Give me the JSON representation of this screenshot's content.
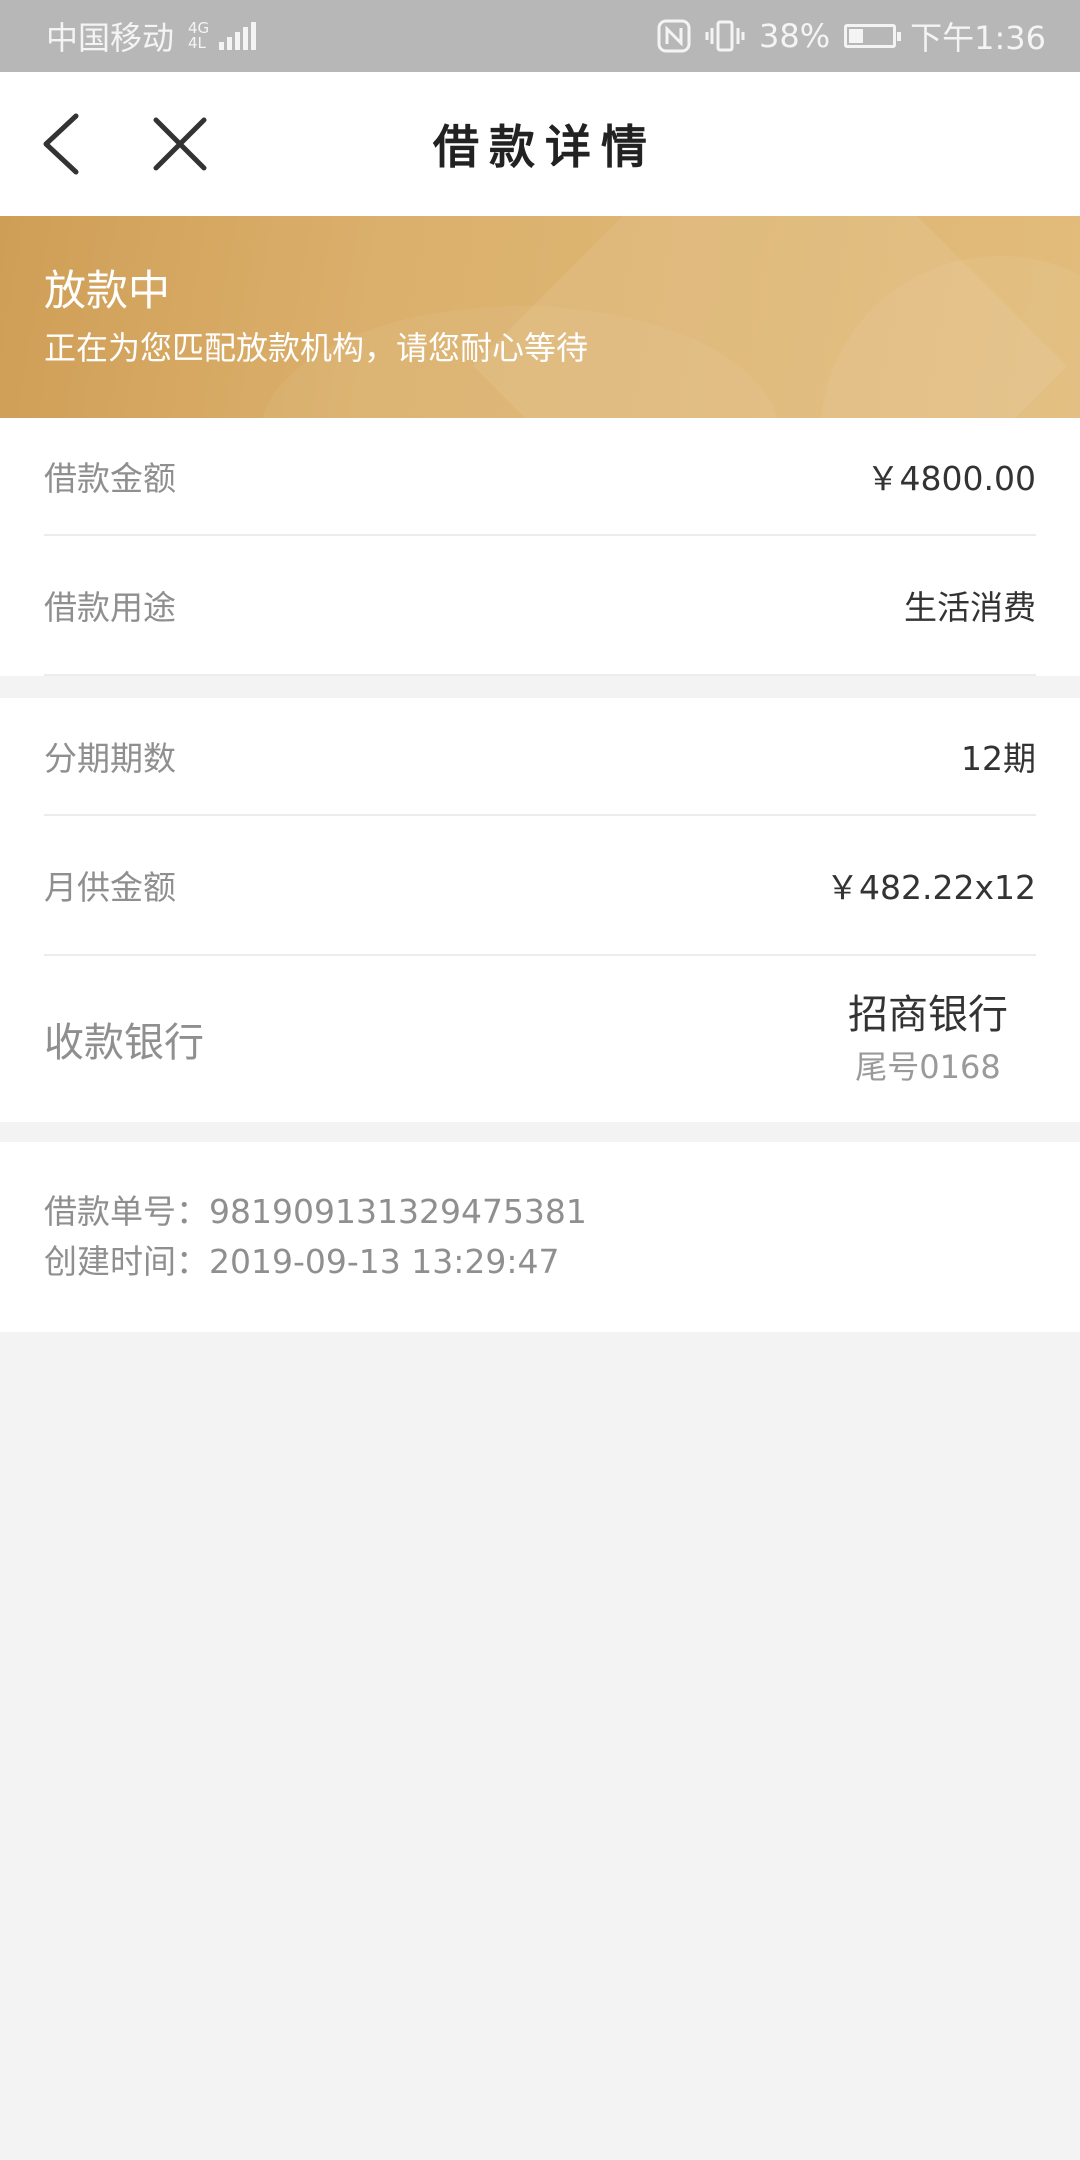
{
  "status_bar": {
    "carrier": "中国移动",
    "network_top": "4G",
    "network_bottom": "4L",
    "battery": "38%",
    "time": "下午1:36"
  },
  "nav": {
    "title": "借款详情"
  },
  "banner": {
    "status": "放款中",
    "description": "正在为您匹配放款机构，请您耐心等待"
  },
  "loan": {
    "amount_label": "借款金额",
    "amount_value": "￥4800.00",
    "purpose_label": "借款用途",
    "purpose_value": "生活消费"
  },
  "repayment": {
    "periods_label": "分期期数",
    "periods_value": "12期",
    "monthly_label": "月供金额",
    "monthly_value": "￥482.22x12",
    "bank_label": "收款银行",
    "bank_name": "招商银行",
    "bank_tail": "尾号0168"
  },
  "order": {
    "number_line": "借款单号：981909131329475381",
    "created_line": "创建时间：2019-09-13 13:29:47"
  }
}
